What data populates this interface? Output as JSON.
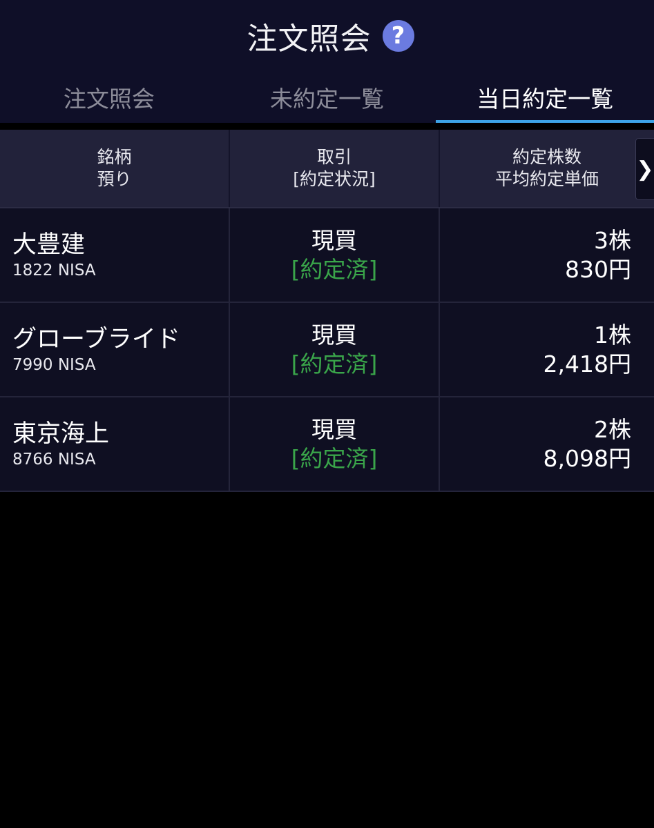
{
  "header": {
    "title": "注文照会",
    "help_icon": "?"
  },
  "tabs": [
    {
      "label": "注文照会",
      "active": false
    },
    {
      "label": "未約定一覧",
      "active": false
    },
    {
      "label": "当日約定一覧",
      "active": true
    }
  ],
  "table": {
    "headers": {
      "col1_line1": "銘柄",
      "col1_line2": "預り",
      "col2_line1": "取引",
      "col2_line2": "[約定状況]",
      "col3_line1": "約定株数",
      "col3_line2": "平均約定単価"
    },
    "scroll_arrow": "❯",
    "rows": [
      {
        "name": "大豊建",
        "code_account": "1822 NISA",
        "trade": "現買",
        "status": "[約定済]",
        "qty": "3株",
        "price": "830円"
      },
      {
        "name": "グローブライド",
        "code_account": "7990 NISA",
        "trade": "現買",
        "status": "[約定済]",
        "qty": "1株",
        "price": "2,418円"
      },
      {
        "name": "東京海上",
        "code_account": "8766 NISA",
        "trade": "現買",
        "status": "[約定済]",
        "qty": "2株",
        "price": "8,098円"
      }
    ]
  },
  "colors": {
    "header_bg": "#0f0f28",
    "accent_underline": "#3da3e6",
    "status_green": "#3aa54a",
    "help_icon_bg": "#6b7be0"
  }
}
